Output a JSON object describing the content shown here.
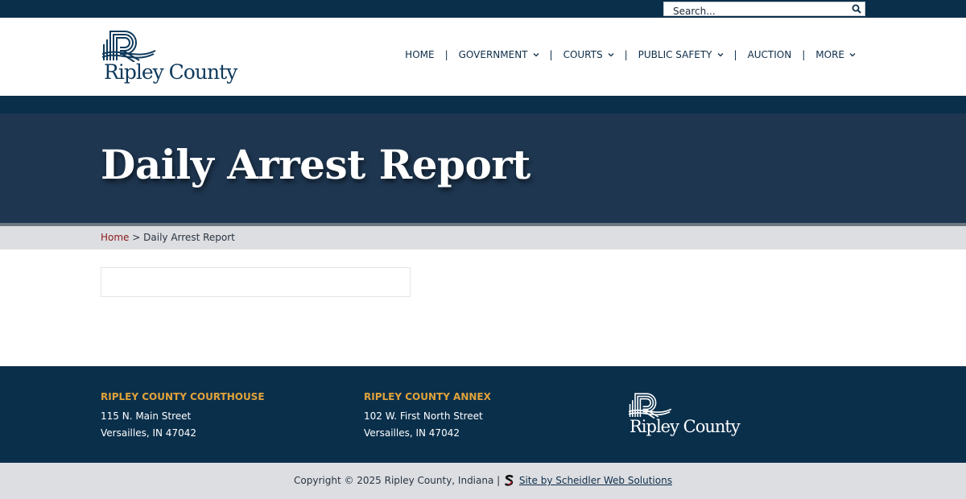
{
  "search": {
    "placeholder": "Search..."
  },
  "logo": {
    "text": "Ripley County"
  },
  "nav": {
    "home": "HOME",
    "government": "GOVERNMENT",
    "courts": "COURTS",
    "public_safety": "PUBLIC SAFETY",
    "auction": "AUCTION",
    "more": "MORE",
    "separator": "|"
  },
  "hero": {
    "title": "Daily Arrest Report"
  },
  "breadcrumb": {
    "home": "Home",
    "separator": ">",
    "current": "Daily Arrest Report"
  },
  "footer": {
    "courthouse": {
      "title": "RIPLEY COUNTY COURTHOUSE",
      "line1": "115 N. Main Street",
      "line2": "Versailles, IN 47042"
    },
    "annex": {
      "title": "RIPLEY COUNTY ANNEX",
      "line1": "102 W. First North Street",
      "line2": "Versailles, IN 47042"
    },
    "logo_text": "Ripley County"
  },
  "bottom": {
    "copyright": "Copyright © 2025 Ripley County, Indiana |",
    "credit_link": "Site by Scheidler Web Solutions"
  },
  "colors": {
    "navy": "#0a2f4b",
    "hero": "#1e3650",
    "accent_orange": "#e0a33a",
    "link_red": "#8d1a1a"
  },
  "icons": {
    "search": "search-icon",
    "chevron": "chevron-down-icon",
    "logo_mark": "ripley-logo-mark-icon",
    "scheidler": "scheidler-s-icon"
  }
}
